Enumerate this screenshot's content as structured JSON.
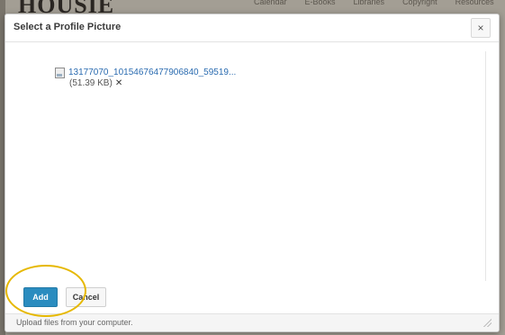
{
  "background": {
    "logo_text": "HOUSIE",
    "nav_items": [
      "Calendar",
      "E-Books",
      "Libraries",
      "Copyright",
      "Resources"
    ]
  },
  "dialog": {
    "title": "Select a Profile Picture",
    "close_glyph": "×",
    "file": {
      "name": "13177070_10154676477906840_59519...",
      "size": "(51.39 KB)",
      "remove_glyph": "✕"
    },
    "buttons": {
      "add_label": "Add",
      "cancel_label": "Cancel"
    },
    "footer_text": "Upload files from your computer."
  },
  "colors": {
    "primary_button": "#2a8cbf",
    "link": "#2a6bb0",
    "annotation": "#e6b800"
  },
  "icons": [
    "close-icon",
    "image-file-icon",
    "remove-icon",
    "resize-grip-icon"
  ]
}
